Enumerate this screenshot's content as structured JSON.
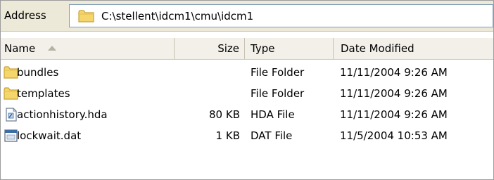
{
  "address": {
    "label": "Address",
    "path": "C:\\stellent\\idcm1\\cmu\\idcm1",
    "icon": "folder-icon"
  },
  "columns": {
    "name": "Name",
    "size": "Size",
    "type": "Type",
    "date": "Date Modified"
  },
  "files": [
    {
      "name": "bundles",
      "size": "",
      "type": "File Folder",
      "date": "11/11/2004 9:26 AM",
      "icon": "folder-icon"
    },
    {
      "name": "templates",
      "size": "",
      "type": "File Folder",
      "date": "11/11/2004 9:26 AM",
      "icon": "folder-icon"
    },
    {
      "name": "actionhistory.hda",
      "size": "80 KB",
      "type": "HDA File",
      "date": "11/11/2004 9:26 AM",
      "icon": "document-icon"
    },
    {
      "name": "lockwait.dat",
      "size": "1 KB",
      "type": "DAT File",
      "date": "11/5/2004 10:53 AM",
      "icon": "window-file-icon"
    }
  ],
  "colors": {
    "folder": "#f5d66b",
    "folder_edge": "#c9a23a",
    "chrome": "#ece9d8"
  }
}
